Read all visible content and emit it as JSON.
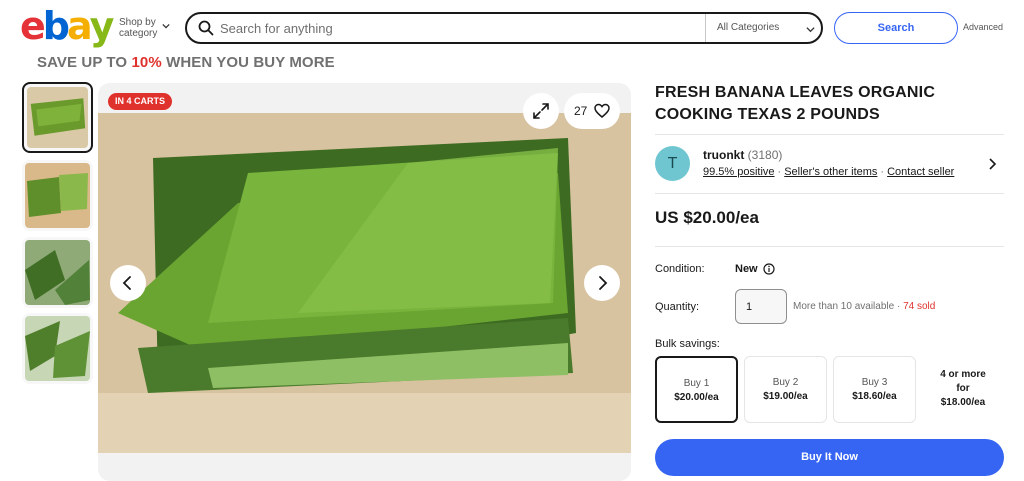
{
  "header": {
    "logo_letters": [
      "e",
      "b",
      "a",
      "y"
    ],
    "logo_colors": [
      "#e53238",
      "#0064d2",
      "#f5af02",
      "#86b817"
    ],
    "shop_by_line1": "Shop by",
    "shop_by_line2": "category",
    "search_placeholder": "Search for anything",
    "category_select": "All Categories",
    "search_button": "Search",
    "advanced_link": "Advanced"
  },
  "promo": {
    "prefix": "SAVE UP TO ",
    "percent": "10%",
    "suffix": " WHEN YOU BUY MORE"
  },
  "gallery": {
    "thumbnail_count": 4,
    "selected_index": 0,
    "cart_badge": "IN 4 CARTS",
    "watch_count": "27",
    "icons": [
      "expand-icon",
      "heart-icon",
      "chevron-left-icon",
      "chevron-right-icon"
    ]
  },
  "listing": {
    "title": "FRESH BANANA LEAVES ORGANIC COOKING TEXAS 2 POUNDS",
    "seller": {
      "avatar_letter": "T",
      "name": "truonkt",
      "feedback_count": "(3180)",
      "positive": "99.5% positive",
      "other_items": "Seller's other items",
      "contact": "Contact seller"
    },
    "price": "US $20.00/ea",
    "condition_label": "Condition:",
    "condition_value": "New",
    "quantity_label": "Quantity:",
    "quantity_value": "1",
    "availability": "More than 10 available",
    "availability_sep": " · ",
    "sold": "74 sold",
    "bulk_label": "Bulk savings:",
    "bulk_options": [
      {
        "title": "Buy 1",
        "price": "$20.00/ea"
      },
      {
        "title": "Buy 2",
        "price": "$19.00/ea"
      },
      {
        "title": "Buy 3",
        "price": "$18.60/ea"
      }
    ],
    "bulk_more_line1": "4 or more",
    "bulk_more_line2": "for",
    "bulk_more_line3": "$18.00/ea",
    "buy_now": "Buy It Now"
  },
  "colors": {
    "accent_blue": "#3665f3",
    "badge_red": "#e0322d",
    "avatar_teal": "#6fc6d1"
  }
}
